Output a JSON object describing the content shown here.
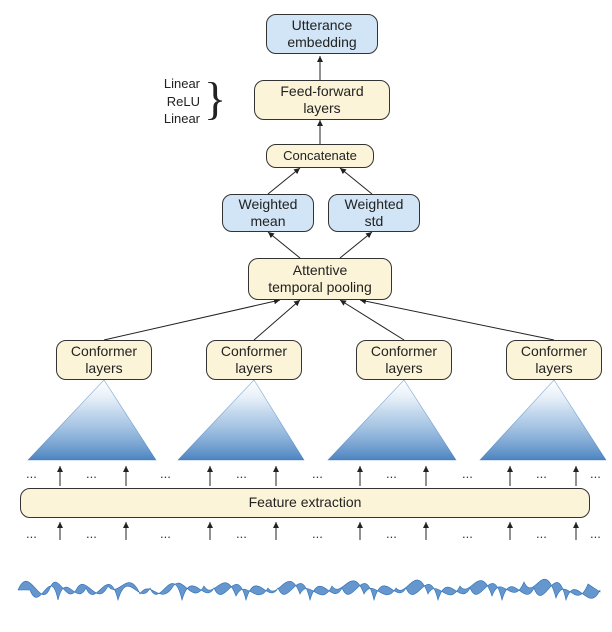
{
  "top": {
    "utterance_embedding": "Utterance\nembedding",
    "feed_forward": "Feed-forward\nlayers",
    "side_labels": {
      "l1": "Linear",
      "l2": "ReLU",
      "l3": "Linear"
    },
    "concatenate": "Concatenate",
    "weighted_mean": "Weighted\nmean",
    "weighted_std": "Weighted\nstd",
    "attentive_pool": "Attentive\ntemporal pooling"
  },
  "conformer": {
    "label": "Conformer\nlayers"
  },
  "feature_extraction": "Feature extraction",
  "ellipsis": "..."
}
